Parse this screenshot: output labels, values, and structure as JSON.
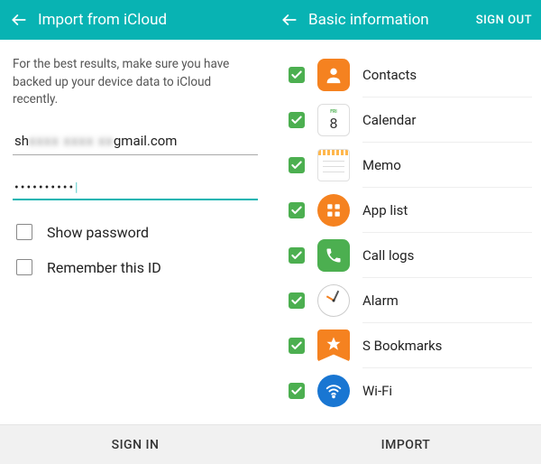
{
  "left": {
    "title": "Import from iCloud",
    "instruction": "For the best results, make sure you have backed up your device data to iCloud recently.",
    "email_prefix": "sh",
    "email_blurred": "xxxx xxxx xx",
    "email_suffix": "gmail.com",
    "password_masked": "••••••••••",
    "show_password_label": "Show password",
    "remember_label": "Remember this ID",
    "footer": "SIGN IN"
  },
  "right": {
    "title": "Basic information",
    "signout": "SIGN OUT",
    "items": [
      {
        "label": "Contacts",
        "icon": "contacts",
        "checked": true
      },
      {
        "label": "Calendar",
        "icon": "calendar",
        "checked": true
      },
      {
        "label": "Memo",
        "icon": "memo",
        "checked": true
      },
      {
        "label": "App list",
        "icon": "applist",
        "checked": true
      },
      {
        "label": "Call logs",
        "icon": "calllogs",
        "checked": true
      },
      {
        "label": "Alarm",
        "icon": "alarm",
        "checked": true
      },
      {
        "label": "S Bookmarks",
        "icon": "bookmarks",
        "checked": true
      },
      {
        "label": "Wi-Fi",
        "icon": "wifi",
        "checked": true
      }
    ],
    "footer": "IMPORT"
  },
  "calendar_day": "8",
  "calendar_top": "FRI"
}
